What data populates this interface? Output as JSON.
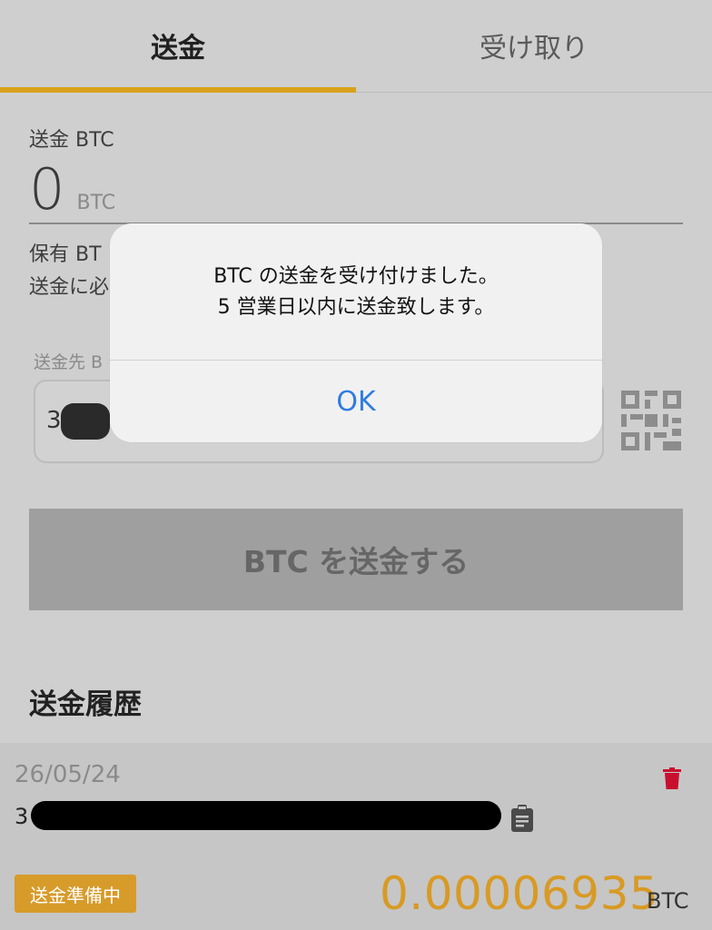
{
  "tabs": {
    "send": "送金",
    "receive": "受け取り"
  },
  "form": {
    "amount_label": "送金 BTC",
    "amount_value": "0",
    "amount_unit": "BTC",
    "holding_label": "保有 BT",
    "fee_label": "送金に必",
    "dest_label": "送金先 B",
    "dest_value_prefix": "3"
  },
  "send_button": "BTC を送金する",
  "history": {
    "title": "送金履歴",
    "items": [
      {
        "date": "26/05/24",
        "address_prefix": "3",
        "status": "送金準備中",
        "amount": "0.00006935",
        "unit": "BTC"
      }
    ]
  },
  "dialog": {
    "line1": "BTC の送金を受け付けました。",
    "line2": "5 営業日以内に送金致します。",
    "ok": "OK"
  },
  "colors": {
    "accent": "#d9a21c",
    "ok_blue": "#2f7de0",
    "delete_red": "#c8102e"
  },
  "icons": [
    "qr-code-icon",
    "trash-icon",
    "clipboard-icon"
  ]
}
